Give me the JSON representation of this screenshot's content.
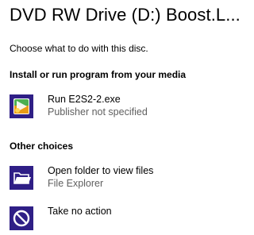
{
  "title": "DVD RW Drive (D:) Boost.L...",
  "subtitle": "Choose what to do with this disc.",
  "sections": [
    {
      "heading": "Install or run program from your media",
      "items": [
        {
          "label": "Run E2S2-2.exe",
          "sub": "Publisher not specified",
          "icon": "installer-icon"
        }
      ]
    },
    {
      "heading": "Other choices",
      "items": [
        {
          "label": "Open folder to view files",
          "sub": "File Explorer",
          "icon": "folder-icon"
        },
        {
          "label": "Take no action",
          "sub": "",
          "icon": "no-action-icon"
        }
      ]
    }
  ],
  "colors": {
    "accent": "#2f1f86",
    "installer_green": "#5cb85c",
    "installer_orange": "#e8a317",
    "secondary_text": "#5f5f5f"
  }
}
